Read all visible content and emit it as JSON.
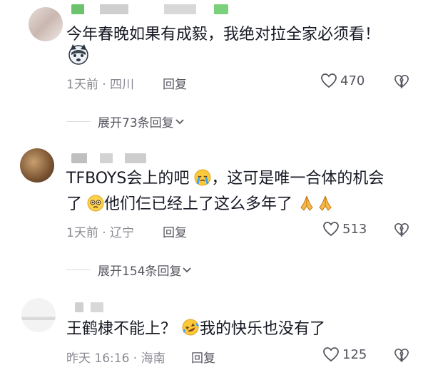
{
  "comments": [
    {
      "text": "今年春晚如果有成毅，我绝对拉全家必须看！",
      "meta": "1天前 · 四川",
      "reply_label": "回复",
      "likes": "470",
      "expand_label": "展开73条回复"
    },
    {
      "text_line1": "TFBOYS会上的吧",
      "text_line1b": "，这可是唯一合体的机会",
      "text_line2a": "了",
      "text_line2b": "他们仨已经上了这么多年了",
      "meta": "1天前 · 辽宁",
      "reply_label": "回复",
      "likes": "513",
      "expand_label": "展开154条回复"
    },
    {
      "text_a": "王鹤棣不能上？",
      "text_b": "我的快乐也没有了",
      "meta": "昨天 16:16 · 海南",
      "reply_label": "回复",
      "likes": "125"
    }
  ]
}
